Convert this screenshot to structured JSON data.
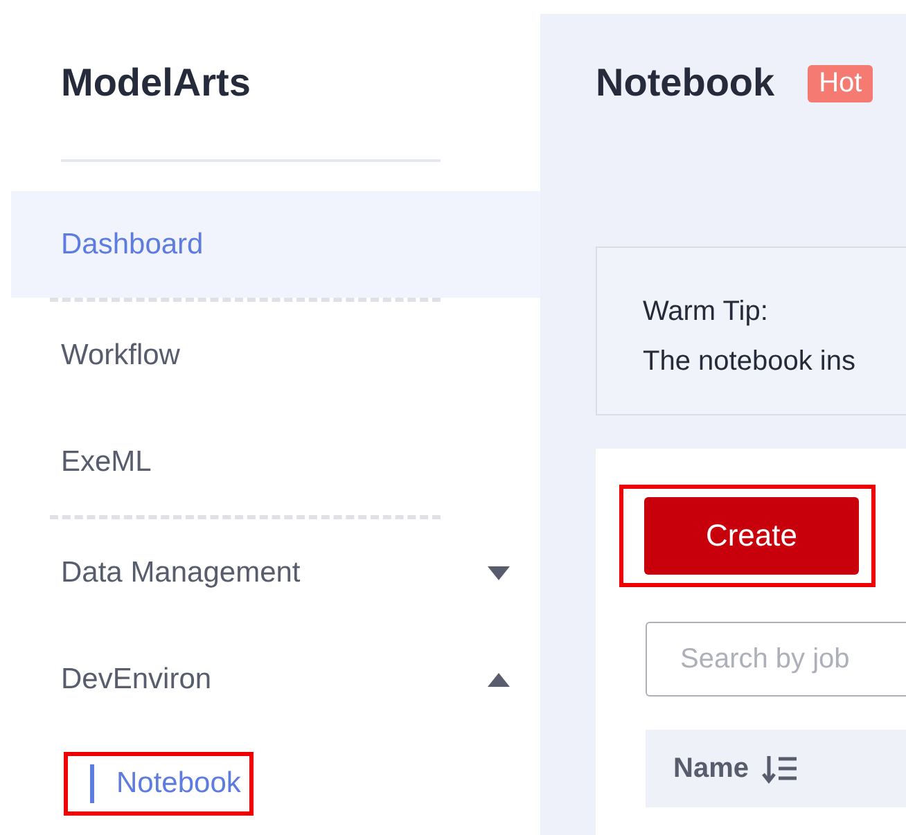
{
  "sidebar": {
    "title": "ModelArts",
    "items": [
      {
        "label": "Dashboard",
        "kind": "link",
        "selected": true,
        "separator": true
      },
      {
        "label": "Workflow",
        "kind": "link",
        "selected": false,
        "separator": false
      },
      {
        "label": "ExeML",
        "kind": "link",
        "selected": false,
        "separator": true
      },
      {
        "label": "Data Management",
        "kind": "group",
        "expanded": false,
        "separator": false
      },
      {
        "label": "DevEnviron",
        "kind": "group",
        "expanded": true,
        "separator": false,
        "children": [
          {
            "label": "Notebook",
            "selected": true,
            "annotated": true
          }
        ]
      }
    ]
  },
  "page": {
    "title": "Notebook",
    "badge": "Hot"
  },
  "tip": {
    "heading": "Warm Tip:",
    "text": "The notebook ins"
  },
  "create_button": {
    "label": "Create",
    "annotated": true
  },
  "search": {
    "placeholder": "Search by job"
  },
  "table": {
    "columns": [
      {
        "label": "Name"
      }
    ]
  }
}
